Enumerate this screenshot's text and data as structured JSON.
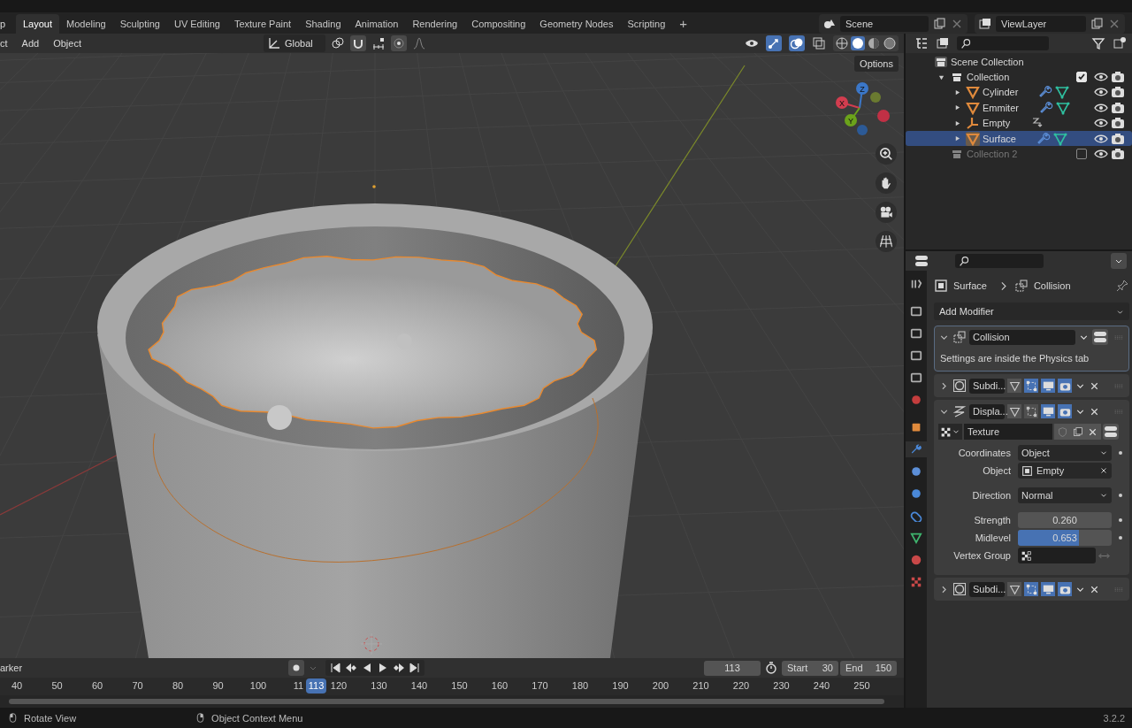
{
  "topbar": {
    "menu_cut": "p",
    "workspaces": [
      {
        "label": "Layout",
        "selected": true
      },
      {
        "label": "Modeling",
        "selected": false
      },
      {
        "label": "Sculpting",
        "selected": false
      },
      {
        "label": "UV Editing",
        "selected": false
      },
      {
        "label": "Texture Paint",
        "selected": false
      },
      {
        "label": "Shading",
        "selected": false
      },
      {
        "label": "Animation",
        "selected": false
      },
      {
        "label": "Rendering",
        "selected": false
      },
      {
        "label": "Compositing",
        "selected": false
      },
      {
        "label": "Geometry Nodes",
        "selected": false
      },
      {
        "label": "Scripting",
        "selected": false
      }
    ],
    "add_tab": "+",
    "scene": "Scene",
    "view_layer": "ViewLayer"
  },
  "viewport_header": {
    "menus": [
      "ct",
      "Add",
      "Object"
    ],
    "orientation": "Global"
  },
  "viewport": {
    "options": "Options",
    "gizmo_axes": [
      "X",
      "Y",
      "Z"
    ]
  },
  "outliner": {
    "items": [
      {
        "name": "Scene Collection",
        "kind": "scene",
        "selected": false,
        "children": [
          {
            "name": "Collection",
            "kind": "collection",
            "expanded": true,
            "checked": true,
            "selected": false,
            "children": [
              {
                "name": "Cylinder",
                "kind": "mesh",
                "expanded": false,
                "selected": false
              },
              {
                "name": "Emmiter",
                "kind": "mesh",
                "expanded": false,
                "selected": false
              },
              {
                "name": "Empty",
                "kind": "empty",
                "expanded": false,
                "selected": false
              },
              {
                "name": "Surface",
                "kind": "mesh",
                "expanded": false,
                "selected": true
              }
            ]
          },
          {
            "name": "Collection 2",
            "kind": "collection",
            "checked": false,
            "selected": false
          }
        ]
      }
    ]
  },
  "properties": {
    "tabs": [
      {
        "kind": "tool",
        "selected": false
      },
      {
        "kind": "render",
        "selected": false
      },
      {
        "kind": "output",
        "selected": false
      },
      {
        "kind": "view-layer",
        "selected": false
      },
      {
        "kind": "scene",
        "selected": false
      },
      {
        "kind": "world",
        "selected": false
      },
      {
        "kind": "object",
        "selected": false
      },
      {
        "kind": "modifier",
        "selected": true
      },
      {
        "kind": "particles",
        "selected": false
      },
      {
        "kind": "physics",
        "selected": false
      },
      {
        "kind": "constraints",
        "selected": false
      },
      {
        "kind": "data",
        "selected": false
      },
      {
        "kind": "material",
        "selected": false
      },
      {
        "kind": "texture",
        "selected": false
      }
    ],
    "breadcrumb": [
      "Surface",
      "Collision"
    ],
    "add_modifier": "Add Modifier",
    "modifiers": [
      {
        "kind": "collision",
        "name": "Collision",
        "expanded": true,
        "active": true,
        "note": "Settings are inside the Physics tab"
      },
      {
        "kind": "subdivision",
        "name": "Subdi...",
        "expanded": false,
        "active": false,
        "edit_mode": true
      },
      {
        "kind": "displace",
        "name": "Displa...",
        "expanded": true,
        "active": false,
        "edit_mode": false,
        "texture": "Texture",
        "field_groups": [
          [
            {
              "kind": "dropdown",
              "label": "Coordinates",
              "value": "Object",
              "animatable": true
            },
            {
              "kind": "object",
              "label": "Object",
              "value": "Empty",
              "animatable": false
            }
          ],
          [
            {
              "kind": "dropdown",
              "label": "Direction",
              "value": "Normal",
              "animatable": true
            }
          ],
          [
            {
              "kind": "number",
              "label": "Strength",
              "value": "0.260",
              "animatable": true
            },
            {
              "kind": "slider",
              "label": "Midlevel",
              "value": "0.653",
              "level": 0.653,
              "animatable": true
            },
            {
              "kind": "vertex-group",
              "label": "Vertex Group",
              "animatable": false
            }
          ]
        ]
      },
      {
        "kind": "subdivision",
        "name": "Subdi...",
        "expanded": false,
        "active": false,
        "edit_mode": true
      }
    ]
  },
  "timeline": {
    "marker_menu": "arker",
    "current_frame": "113",
    "start_label": "Start",
    "start": "30",
    "end_label": "End",
    "end": "150",
    "ticks": [
      "40",
      "50",
      "60",
      "70",
      "80",
      "90",
      "100",
      "11",
      "120",
      "130",
      "140",
      "150",
      "160",
      "170",
      "180",
      "190",
      "200",
      "210",
      "220",
      "230",
      "240",
      "250"
    ],
    "playhead": "113"
  },
  "status_bar": {
    "items": [
      "Rotate View",
      "Object Context Menu"
    ],
    "version": "3.2.2"
  }
}
